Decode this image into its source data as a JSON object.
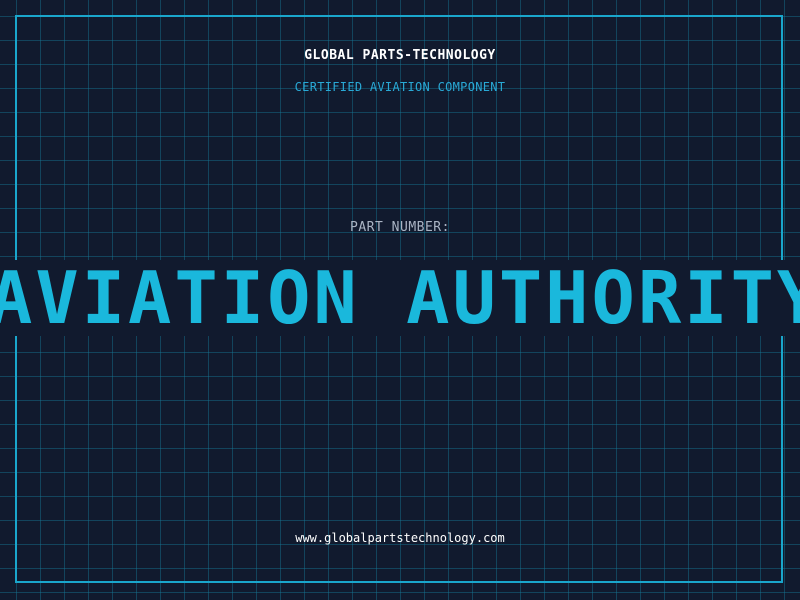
{
  "header": {
    "company": "GLOBAL PARTS-TECHNOLOGY",
    "subtitle": "CERTIFIED AVIATION COMPONENT"
  },
  "part": {
    "label": "PART NUMBER:",
    "value": "AVIATION AUTHORITY"
  },
  "footer": {
    "url": "www.globalpartstechnology.com"
  },
  "colors": {
    "background": "#111a2e",
    "grid": "#1678a0",
    "frame": "#1aa6cc",
    "accent": "#1ab8dc"
  }
}
